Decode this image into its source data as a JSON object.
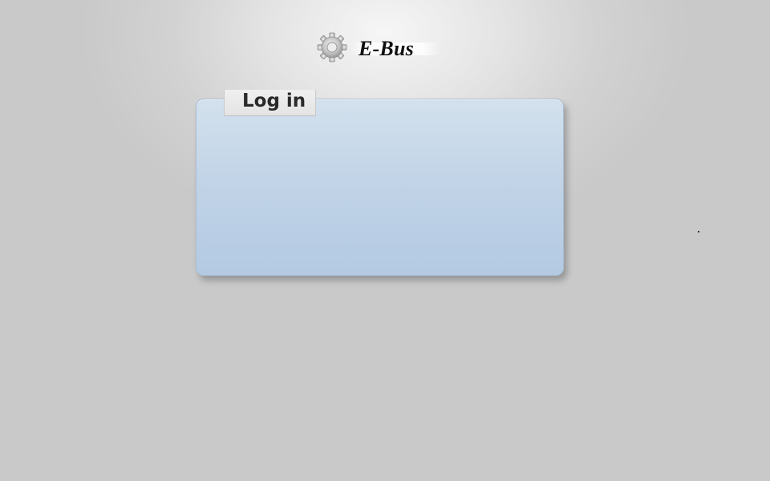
{
  "header": {
    "app_name": "E-Bus",
    "logo_icon": "gear-icon"
  },
  "login": {
    "title": "Log in"
  },
  "colors": {
    "panel_top": "#d3e1ed",
    "panel_bottom": "#b3cae3",
    "background": "#d2d2d2"
  }
}
